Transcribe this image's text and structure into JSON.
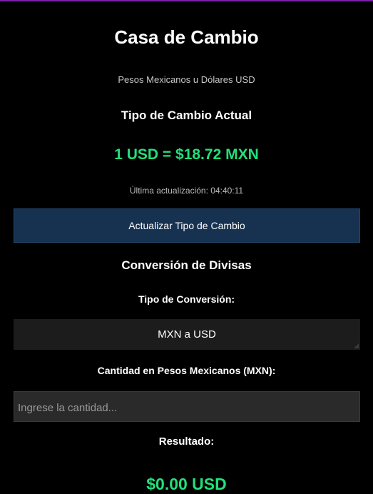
{
  "app": {
    "title": "Casa de Cambio",
    "subtitle": "Pesos Mexicanos u Dólares USD",
    "accent_color": "#22e07a",
    "top_border_color": "#7a1fa6"
  },
  "rate": {
    "heading": "Tipo de Cambio Actual",
    "value": "1 USD = $18.72 MXN",
    "last_update": "Última actualización: 04:40:11",
    "refresh_label": "Actualizar Tipo de Cambio"
  },
  "conversion": {
    "heading": "Conversión de Divisas",
    "type_label": "Tipo de Conversión:",
    "type_selected": "MXN a USD",
    "amount_label": "Cantidad en Pesos Mexicanos (MXN):",
    "amount_value": "",
    "amount_placeholder": "Ingrese la cantidad...",
    "result_label": "Resultado:",
    "result_value": "$0.00 USD"
  }
}
